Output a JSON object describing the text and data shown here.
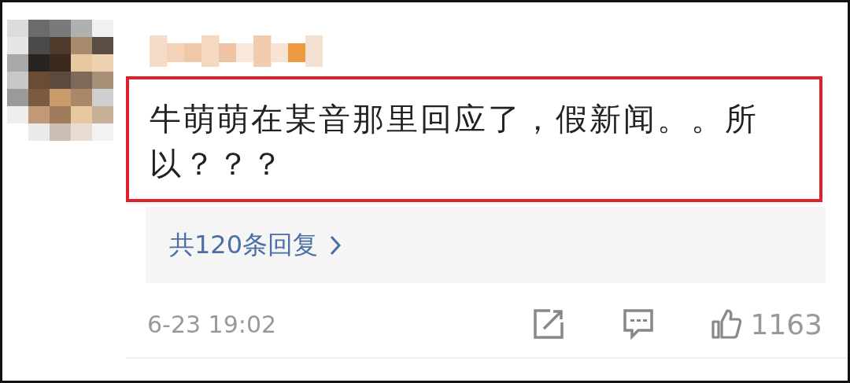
{
  "comment": {
    "text": "牛萌萌在某音那里回应了，假新闻。。所以？？？",
    "highlighted": true
  },
  "replies": {
    "label": "共120条回复"
  },
  "footer": {
    "time": "6-23 19:02",
    "likes": "1163"
  }
}
